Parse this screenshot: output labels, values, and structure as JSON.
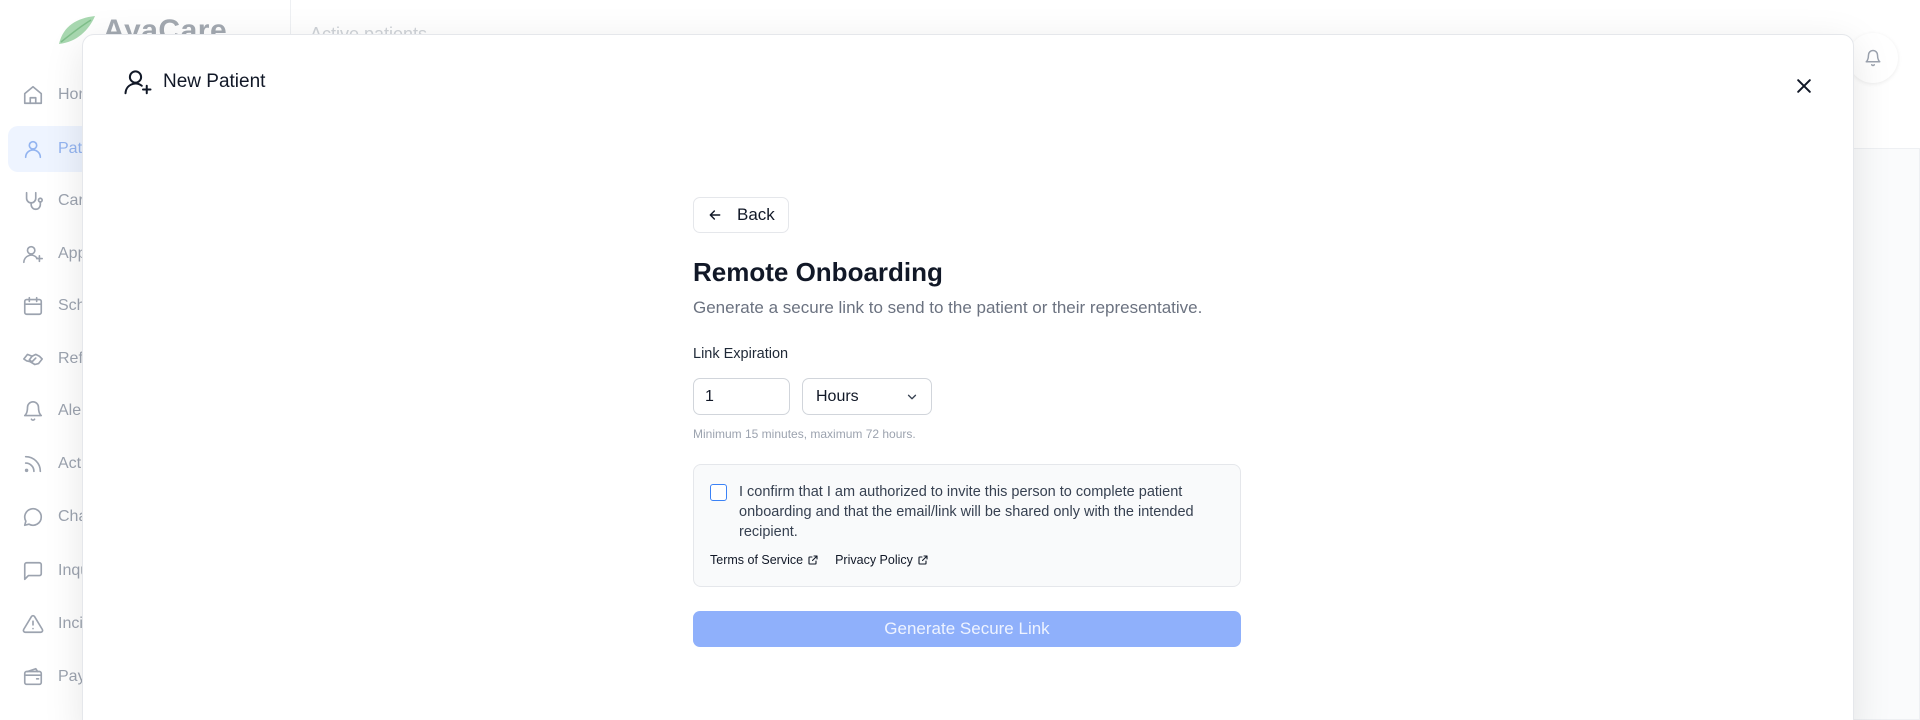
{
  "app": {
    "logo_text": "AyaCare",
    "topbar_text": "Active patients",
    "colors": {
      "brand_green": "#9bd3a5",
      "primary_blue": "#3b82f6",
      "disabled_button": "#8fb0fb"
    }
  },
  "sidebar": {
    "items": [
      {
        "label": "Home",
        "icon": "home-icon",
        "active": false
      },
      {
        "label": "Patients",
        "icon": "user-icon",
        "active": true
      },
      {
        "label": "Care",
        "icon": "stethoscope-icon",
        "active": false
      },
      {
        "label": "Applicants",
        "icon": "user-plus-icon",
        "active": false
      },
      {
        "label": "Schedule",
        "icon": "calendar-icon",
        "active": false
      },
      {
        "label": "Referrals",
        "icon": "handshake-icon",
        "active": false
      },
      {
        "label": "Alerts",
        "icon": "bell-icon",
        "active": false
      },
      {
        "label": "Activity",
        "icon": "rss-icon",
        "active": false
      },
      {
        "label": "Chat",
        "icon": "chat-icon",
        "active": false
      },
      {
        "label": "Inquiries",
        "icon": "message-square-icon",
        "active": false
      },
      {
        "label": "Incidents",
        "icon": "warning-icon",
        "active": false
      },
      {
        "label": "Payroll",
        "icon": "wallet-icon",
        "active": false
      }
    ]
  },
  "modal": {
    "title": "New Patient",
    "title_icon": "user-plus-icon",
    "close_icon": "close-icon",
    "back_label": "Back",
    "heading": "Remote Onboarding",
    "subtitle": "Generate a secure link to send to the patient or their representative.",
    "expiration": {
      "label": "Link Expiration",
      "value": "1",
      "unit": "Hours",
      "hint": "Minimum 15 minutes, maximum 72 hours."
    },
    "consent": {
      "checked": false,
      "text": "I confirm that I am authorized to invite this person to complete patient onboarding and that the email/link will be shared only with the intended recipient.",
      "terms_label": "Terms of Service",
      "privacy_label": "Privacy Policy"
    },
    "generate_label": "Generate Secure Link",
    "generate_disabled": true
  }
}
